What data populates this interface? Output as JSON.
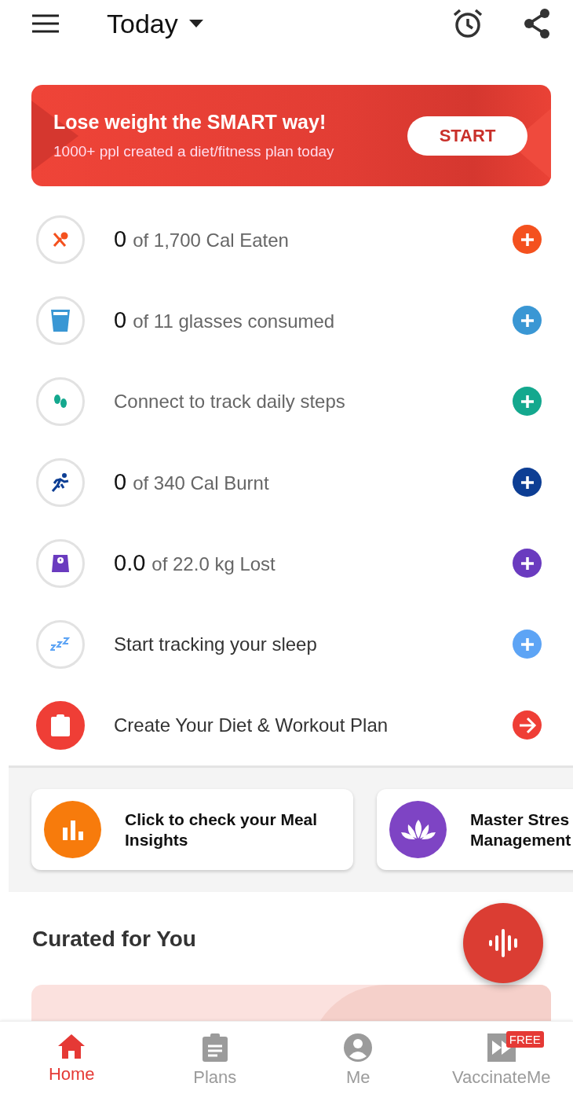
{
  "header": {
    "title": "Today"
  },
  "banner": {
    "title": "Lose weight the SMART way!",
    "subtitle": "1000+ ppl created a diet/fitness plan today",
    "button": "START"
  },
  "trackers": [
    {
      "kind": "meal",
      "value": "0",
      "text": "of 1,700 Cal Eaten",
      "color": "#f4511e"
    },
    {
      "kind": "water",
      "value": "0",
      "text": "of 11 glasses consumed",
      "color": "#3a97d4"
    },
    {
      "kind": "steps",
      "text": "Connect to track daily steps",
      "color": "#14a88e"
    },
    {
      "kind": "exercise",
      "value": "0",
      "text": "of 340 Cal Burnt",
      "color": "#0d3e94"
    },
    {
      "kind": "weight",
      "value": "0.0",
      "text": "of 22.0 kg Lost",
      "color": "#6a3bbf"
    },
    {
      "kind": "sleep",
      "text": "Start tracking your sleep",
      "color": "#5da4f5"
    },
    {
      "kind": "plan",
      "text": "Create Your Diet & Workout Plan",
      "color": "#ef3e36"
    }
  ],
  "insight_cards": [
    {
      "kind": "meal",
      "title": "Click to check your Meal Insights",
      "color": "#f77b0c"
    },
    {
      "kind": "stress",
      "title": "Master Stres",
      "title_line_2": "Management",
      "color": "#7e44c4"
    }
  ],
  "curated": {
    "title": "Curated for You"
  },
  "bottom_nav": [
    {
      "label": "Home",
      "selected": true
    },
    {
      "label": "Plans",
      "selected": false
    },
    {
      "label": "Me",
      "selected": false
    },
    {
      "label": "VaccinateMe",
      "selected": false,
      "badge": "FREE"
    }
  ]
}
